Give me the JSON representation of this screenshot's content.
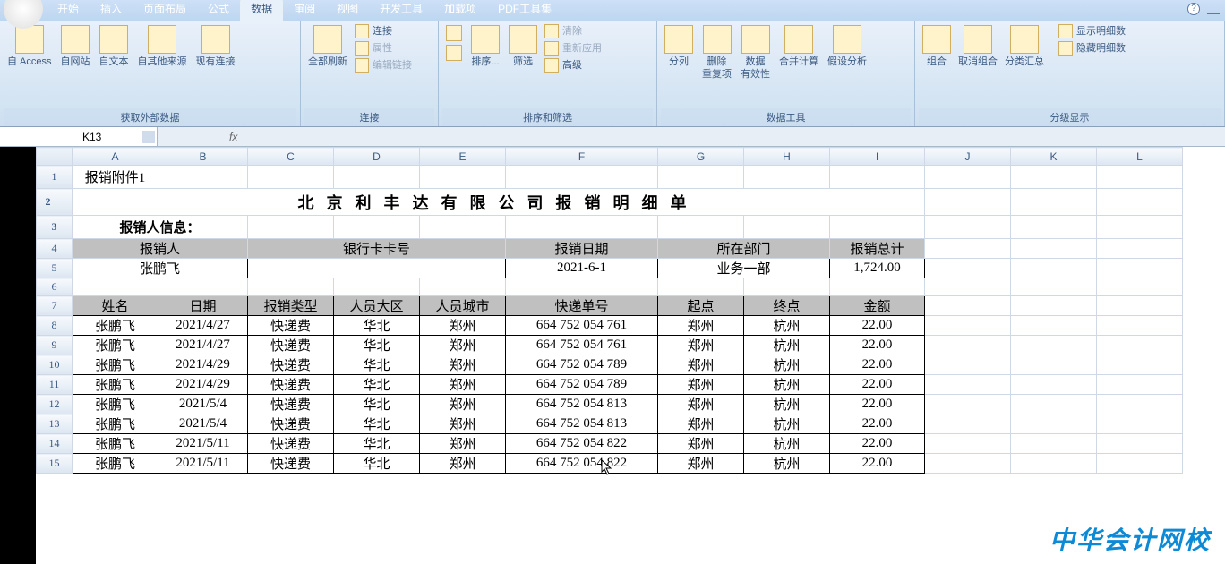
{
  "tabs": {
    "items": [
      "开始",
      "插入",
      "页面布局",
      "公式",
      "数据",
      "审阅",
      "视图",
      "开发工具",
      "加载项",
      "PDF工具集"
    ],
    "active": 4
  },
  "ribbon": {
    "groups": {
      "ext": {
        "label": "获取外部数据",
        "btns": [
          "自 Access",
          "自网站",
          "自文本",
          "自其他来源",
          "现有连接"
        ]
      },
      "conn": {
        "label": "连接",
        "refresh": "全部刷新",
        "sub": [
          "连接",
          "属性",
          "编辑链接"
        ]
      },
      "sort": {
        "label": "排序和筛选",
        "sortbtn": "排序...",
        "filter": "筛选",
        "sub": [
          "清除",
          "重新应用",
          "高级"
        ]
      },
      "tools": {
        "label": "数据工具",
        "btns": [
          "分列",
          "删除\n重复项",
          "数据\n有效性",
          "合并计算",
          "假设分析"
        ]
      },
      "outline": {
        "label": "分级显示",
        "btns": [
          "组合",
          "取消组合",
          "分类汇总"
        ],
        "side": [
          "显示明细数",
          "隐藏明细数"
        ]
      }
    }
  },
  "namebox": {
    "ref": "K13"
  },
  "cols": [
    "A",
    "B",
    "C",
    "D",
    "E",
    "F",
    "G",
    "H",
    "I",
    "J",
    "K",
    "L"
  ],
  "sheet": {
    "r1": {
      "a": "报销附件1"
    },
    "r2_title": "北京利丰达有限公司报销明细单",
    "r3": {
      "a": "报销人信息："
    },
    "r4": {
      "a": "报销人",
      "b_e": "银行卡卡号",
      "f": "报销日期",
      "g_h": "所在部门",
      "i": "报销总计"
    },
    "r5": {
      "a": "张鹏飞",
      "f": "2021-6-1",
      "g_h": "业务一部",
      "i": "1,724.00"
    },
    "r7": {
      "a": "姓名",
      "b": "日期",
      "c": "报销类型",
      "d": "人员大区",
      "e": "人员城市",
      "f": "快递单号",
      "g": "起点",
      "h": "终点",
      "i": "金额"
    },
    "rows": [
      {
        "n": "8",
        "a": "张鹏飞",
        "b": "2021/4/27",
        "c": "快递费",
        "d": "华北",
        "e": "郑州",
        "f": "664 752 054 761",
        "g": "郑州",
        "h": "杭州",
        "i": "22.00"
      },
      {
        "n": "9",
        "a": "张鹏飞",
        "b": "2021/4/27",
        "c": "快递费",
        "d": "华北",
        "e": "郑州",
        "f": "664 752 054 761",
        "g": "郑州",
        "h": "杭州",
        "i": "22.00"
      },
      {
        "n": "10",
        "a": "张鹏飞",
        "b": "2021/4/29",
        "c": "快递费",
        "d": "华北",
        "e": "郑州",
        "f": "664 752 054 789",
        "g": "郑州",
        "h": "杭州",
        "i": "22.00"
      },
      {
        "n": "11",
        "a": "张鹏飞",
        "b": "2021/4/29",
        "c": "快递费",
        "d": "华北",
        "e": "郑州",
        "f": "664 752 054 789",
        "g": "郑州",
        "h": "杭州",
        "i": "22.00"
      },
      {
        "n": "12",
        "a": "张鹏飞",
        "b": "2021/5/4",
        "c": "快递费",
        "d": "华北",
        "e": "郑州",
        "f": "664 752 054 813",
        "g": "郑州",
        "h": "杭州",
        "i": "22.00"
      },
      {
        "n": "13",
        "a": "张鹏飞",
        "b": "2021/5/4",
        "c": "快递费",
        "d": "华北",
        "e": "郑州",
        "f": "664 752 054 813",
        "g": "郑州",
        "h": "杭州",
        "i": "22.00"
      },
      {
        "n": "14",
        "a": "张鹏飞",
        "b": "2021/5/11",
        "c": "快递费",
        "d": "华北",
        "e": "郑州",
        "f": "664 752 054 822",
        "g": "郑州",
        "h": "杭州",
        "i": "22.00"
      },
      {
        "n": "15",
        "a": "张鹏飞",
        "b": "2021/5/11",
        "c": "快递费",
        "d": "华北",
        "e": "郑州",
        "f": "664 752 054 822",
        "g": "郑州",
        "h": "杭州",
        "i": "22.00"
      }
    ]
  },
  "watermark": "中华会计网校"
}
